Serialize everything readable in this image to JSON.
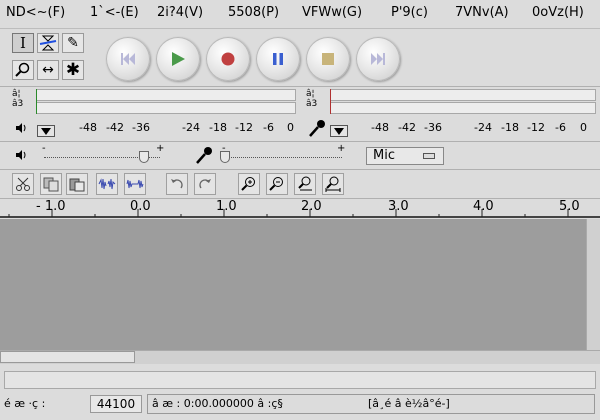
{
  "menu": [
    "ND<~(F)",
    "1`<-(E)",
    "2i?4(V)",
    "5508(P)",
    "VFWw(G)",
    "P'9(c)",
    "7VNv(A)",
    "0oVz(H)"
  ],
  "meters": {
    "channel_top": "â¦",
    "channel_bottom": "â3",
    "scale_left": [
      "-48",
      "-42",
      "-36",
      "-24",
      "-18",
      "-12",
      "-6",
      "0"
    ],
    "scale_right": [
      "-48",
      "-42",
      "-36",
      "-24",
      "-18",
      "-12",
      "-6",
      "0"
    ]
  },
  "mixer": {
    "gain_min": "-",
    "gain_max": "+",
    "input_min": "-",
    "input_max": "+",
    "input_source": "Mic"
  },
  "ruler": [
    "- 1.0",
    "0.0",
    "1.0",
    "2.0",
    "3.0",
    "4.0",
    "5.0"
  ],
  "status": {
    "rate_label": "é æ ·ç :",
    "rate_value": "44100",
    "cursor_text": "â æ : 0:00.000000 â :ç§",
    "extra_text": "[â¸é â è½â°é-]"
  },
  "colors": {
    "track_bg": "#9d9d9d",
    "play_green": "#4a9a4a",
    "record_red": "#c04040",
    "pause_blue": "#3a5fd0",
    "disabled": "#b8b8d8",
    "stop_tan": "#c8b47a"
  }
}
